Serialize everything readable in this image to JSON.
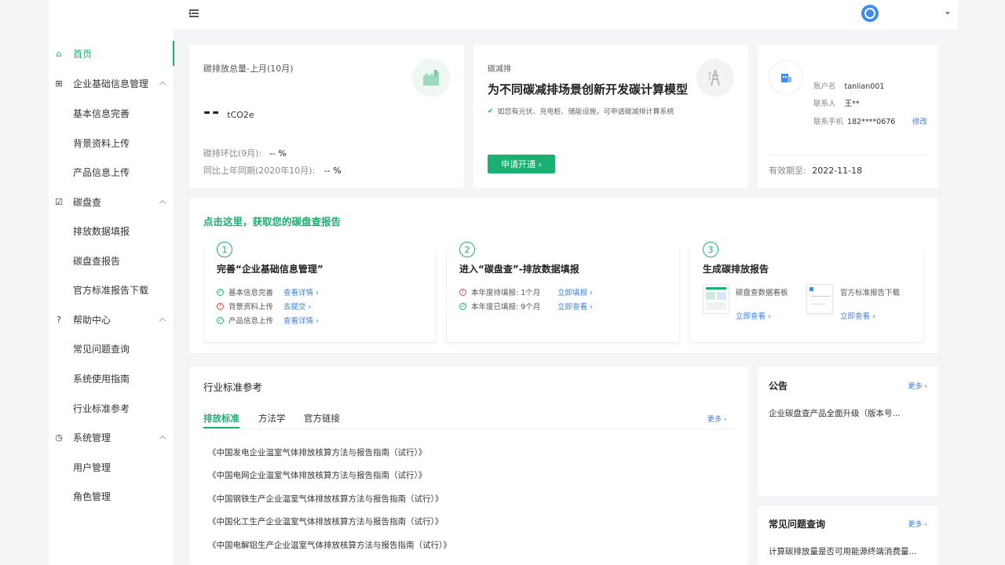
{
  "sidebar": {
    "items": [
      {
        "label": "首页",
        "icon": "home-icon",
        "glyph": "⌂",
        "active": true
      },
      {
        "label": "企业基础信息管理",
        "icon": "building-icon",
        "glyph": "⊞",
        "group": true
      },
      {
        "label": "基本信息完善"
      },
      {
        "label": "背景资料上传"
      },
      {
        "label": "产品信息上传"
      },
      {
        "label": "碳盘查",
        "icon": "checklist-icon",
        "glyph": "☑",
        "group": true
      },
      {
        "label": "排放数据填报"
      },
      {
        "label": "碳盘查报告"
      },
      {
        "label": "官方标准报告下载"
      },
      {
        "label": "帮助中心",
        "icon": "help-icon",
        "glyph": "?",
        "group": true
      },
      {
        "label": "常见问题查询"
      },
      {
        "label": "系统使用指南"
      },
      {
        "label": "行业标准参考"
      },
      {
        "label": "系统管理",
        "icon": "settings-icon",
        "glyph": "◷",
        "group": true
      },
      {
        "label": "用户管理"
      },
      {
        "label": "角色管理"
      }
    ]
  },
  "emission": {
    "title": "碳排放总量-上月(10月)",
    "value": "--",
    "unit": "tCO2e",
    "mom_label": "碳排环比(9月):",
    "mom_value": "-- %",
    "yoy_label": "同比上年同期(2020年10月):",
    "yoy_value": "-- %"
  },
  "reduction": {
    "label": "碳减排",
    "headline": "为不同碳减排场景创新开发碳计算模型",
    "note": "如您有光伏、充电桩、储能设施，可申请碳减排计算系统",
    "button": "申请开通 ›"
  },
  "account": {
    "username_label": "账户名",
    "username": "tanlian001",
    "contact_label": "联系人",
    "contact": "王**",
    "phone_label": "联系手机",
    "phone": "182****0676",
    "edit": "修改",
    "expiry_label": "有效期至:",
    "expiry": "2022-11-18"
  },
  "report": {
    "title": "点击这里，获取您的碳盘查报告",
    "steps": [
      {
        "num": "1",
        "title": "完善“企业基础信息管理”",
        "rows": [
          {
            "status": "ok",
            "text": "基本信息完善",
            "link": "查看详情 ›"
          },
          {
            "status": "warn",
            "text": "背景资料上传",
            "link": "去提交 ›"
          },
          {
            "status": "ok",
            "text": "产品信息上传",
            "link": "查看详情 ›"
          }
        ]
      },
      {
        "num": "2",
        "title": "进入“碳盘查”-排放数据填报",
        "rows": [
          {
            "status": "warn",
            "text": "本年度待填报: 1个月",
            "link": "立即填报 ›"
          },
          {
            "status": "ok",
            "text": "本年度已填报: 9个月",
            "link": "立即查看 ›"
          }
        ]
      },
      {
        "num": "3",
        "title": "生成碳排放报告",
        "docs": [
          {
            "name": "碳盘查数据看板",
            "link": "立即查看 ›"
          },
          {
            "name": "官方标准报告下载",
            "link": "立即查看 ›"
          }
        ]
      }
    ]
  },
  "standards": {
    "title": "行业标准参考",
    "tabs": [
      "排放标准",
      "方法学",
      "官方链接"
    ],
    "more": "更多 ›",
    "items": [
      "《中国发电企业温室气体排放核算方法与报告指南（试行）》",
      "《中国电网企业温室气体排放核算方法与报告指南（试行）》",
      "《中国钢铁生产企业温室气体排放核算方法与报告指南（试行）》",
      "《中国化工生产企业温室气体排放核算方法与报告指南（试行）》",
      "《中国电解铝生产企业温室气体排放核算方法与报告指南（试行）》"
    ]
  },
  "notice": {
    "title": "公告",
    "more": "更多 ›",
    "item": "企业碳盘查产品全面升级（版本号..."
  },
  "faq": {
    "title": "常见问题查询",
    "more": "更多 ›",
    "item": "计算碳排放量是否可用能源终端消费量..."
  },
  "colors": {
    "accent": "#1bb071",
    "link": "#3d7ef0",
    "warn": "#e24a4a"
  }
}
